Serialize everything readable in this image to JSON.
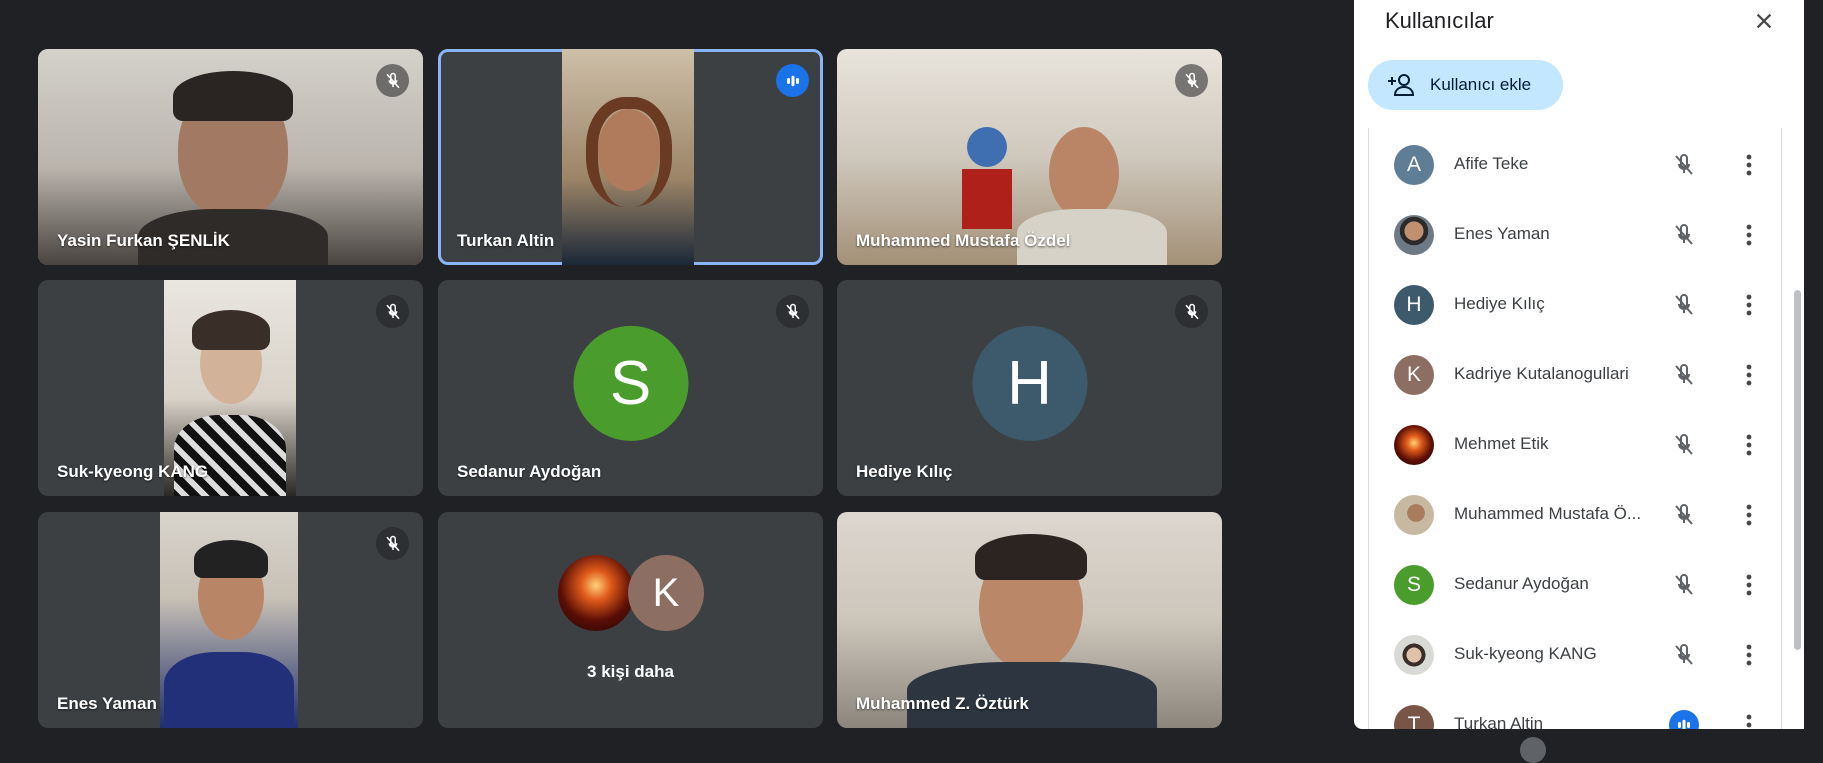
{
  "tiles": [
    {
      "name": "Yasin Furkan ŞENLİK",
      "state": "muted"
    },
    {
      "name": "Turkan Altin",
      "state": "speaking"
    },
    {
      "name": "Muhammed Mustafa Özdel",
      "state": "muted"
    },
    {
      "name": "Suk-kyeong KANG",
      "state": "muted"
    },
    {
      "name": "Sedanur Aydoğan",
      "state": "muted",
      "initial": "S",
      "color": "#4a9c2d"
    },
    {
      "name": "Hediye Kılıç",
      "state": "muted",
      "initial": "H",
      "color": "#3d5a6c"
    },
    {
      "name": "Enes Yaman",
      "state": "muted"
    },
    {
      "more_label": "3 kişi daha",
      "initial": "K",
      "color": "#8d6e63"
    },
    {
      "name": "Muhammed Z. Öztürk",
      "state": "none"
    }
  ],
  "panel": {
    "title": "Kullanıcılar",
    "add_button": "Kullanıcı ekle",
    "participants": [
      {
        "name": "Afife Teke",
        "initial": "A",
        "color": "#5f7d95",
        "mic": "muted"
      },
      {
        "name": "Enes Yaman",
        "initial": "",
        "color": "#6d7a85",
        "mic": "muted"
      },
      {
        "name": "Hediye Kılıç",
        "initial": "H",
        "color": "#3d5a6c",
        "mic": "muted"
      },
      {
        "name": "Kadriye Kutalanogullari",
        "initial": "K",
        "color": "#8d6e63",
        "mic": "muted"
      },
      {
        "name": "Mehmet Etik",
        "initial": "",
        "color": "#7a1f10",
        "mic": "muted"
      },
      {
        "name": "Muhammed Mustafa Ö...",
        "initial": "",
        "color": "#a39077",
        "mic": "muted"
      },
      {
        "name": "Sedanur Aydoğan",
        "initial": "S",
        "color": "#4a9c2d",
        "mic": "muted"
      },
      {
        "name": "Suk-kyeong KANG",
        "initial": "",
        "color": "#9a9a98",
        "mic": "muted"
      },
      {
        "name": "Turkan Altin",
        "initial": "T",
        "color": "#795548",
        "mic": "speaking"
      }
    ]
  },
  "colors": {
    "background": "#202124",
    "tile": "#3c4043",
    "accent": "#1a73e8",
    "speaking_border": "#8ab4f8"
  }
}
